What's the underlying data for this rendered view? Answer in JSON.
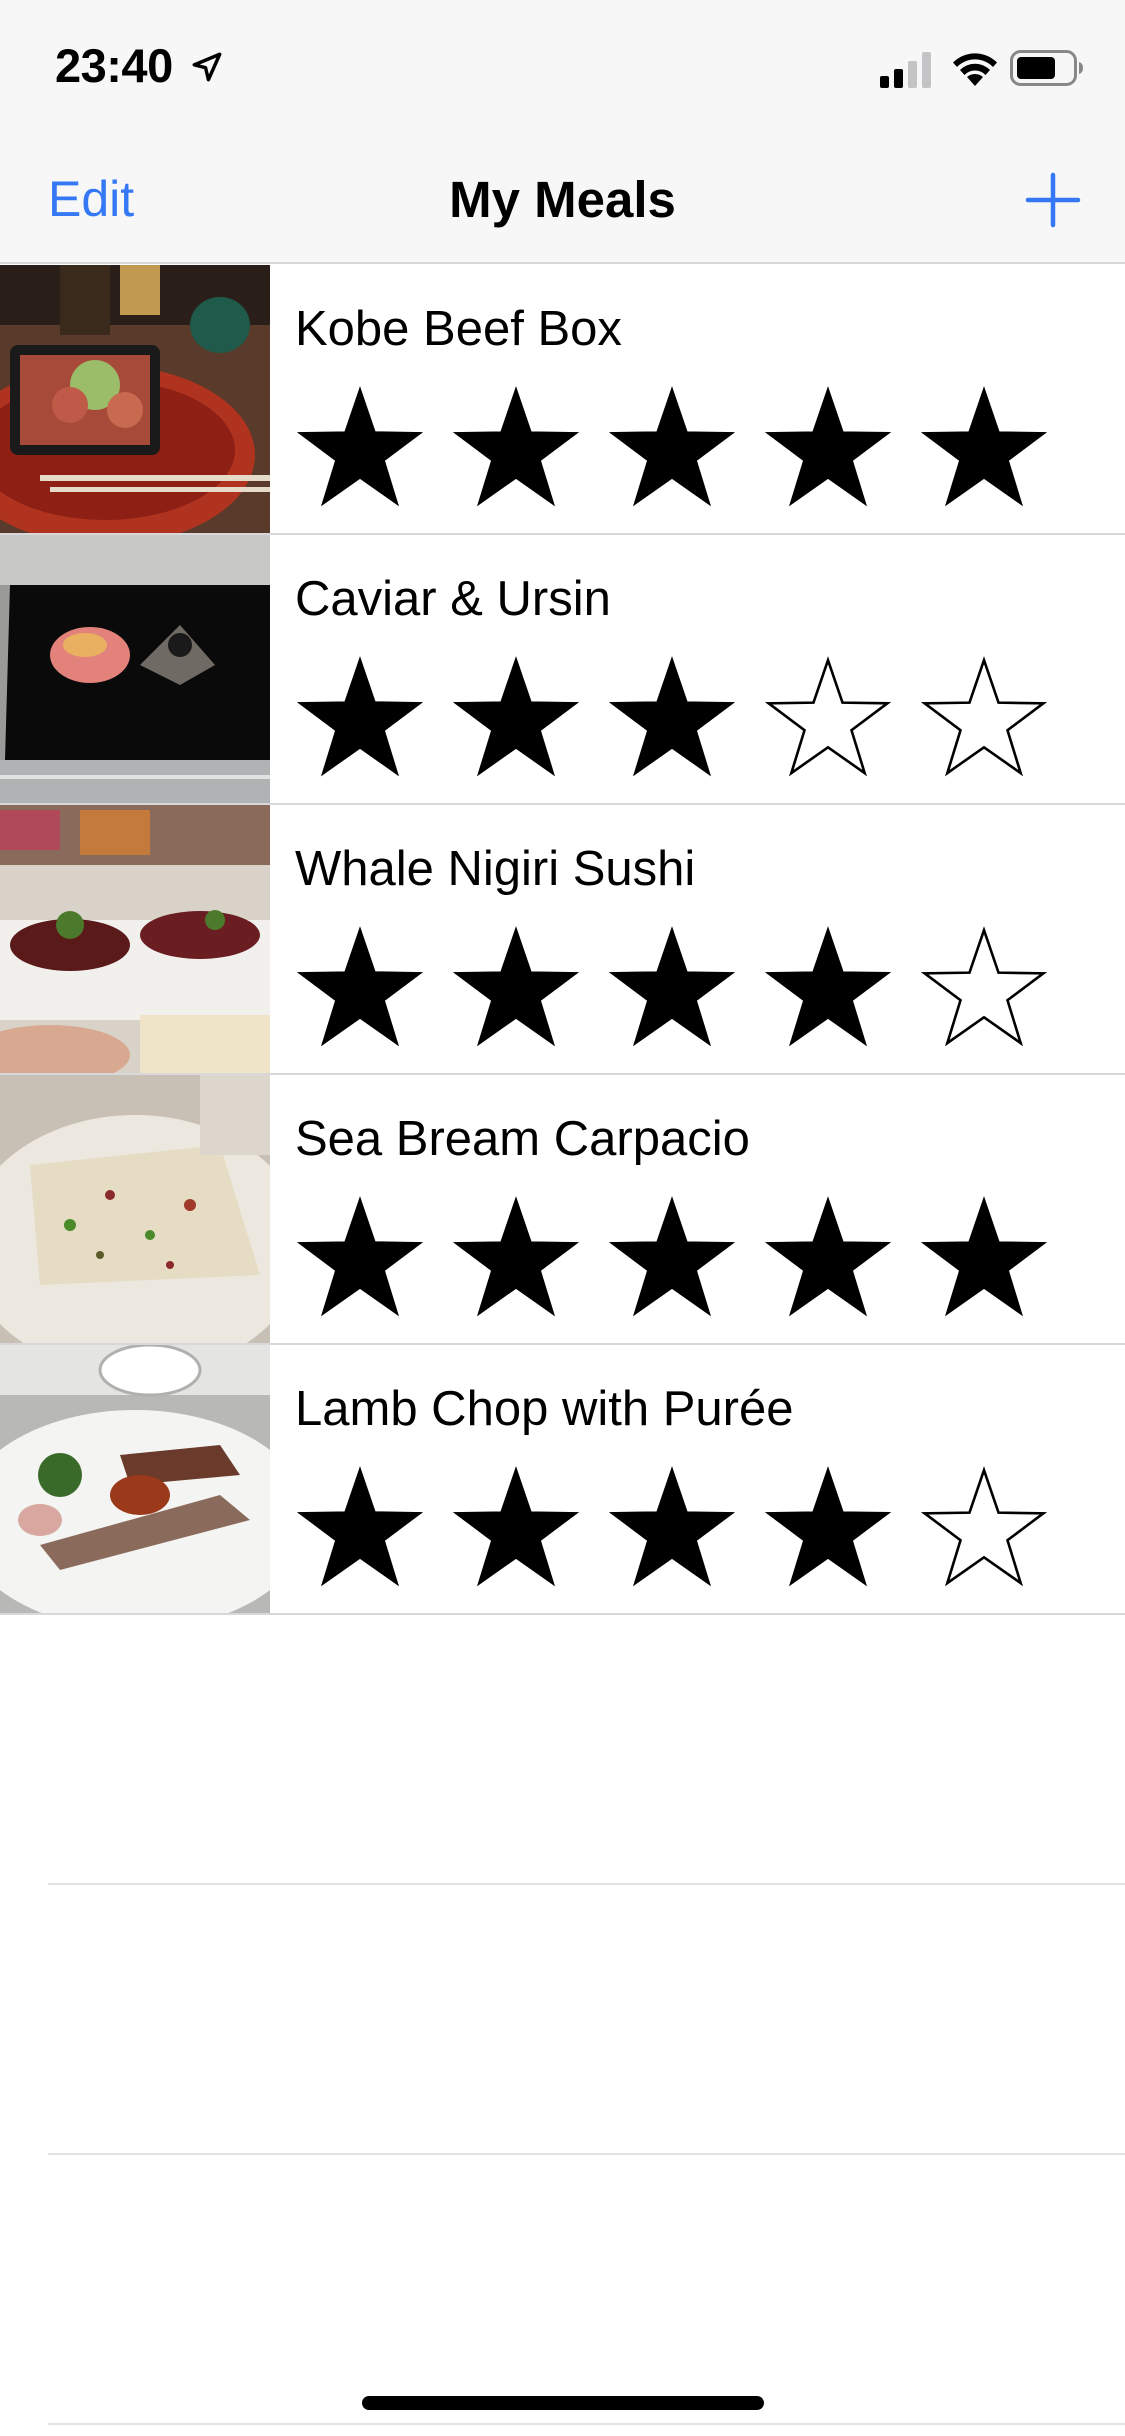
{
  "status_bar": {
    "time": "23:40",
    "icons": [
      "location-icon",
      "cellular-signal-icon",
      "wifi-icon",
      "battery-icon"
    ]
  },
  "nav": {
    "edit_label": "Edit",
    "title": "My Meals",
    "add_icon": "plus-icon"
  },
  "colors": {
    "accent": "#3478f6",
    "separator": "#d8d8da",
    "bar_background": "#f7f7f7"
  },
  "meals": [
    {
      "name": "Kobe Beef Box",
      "rating": 5,
      "max_rating": 5
    },
    {
      "name": "Caviar & Ursin",
      "rating": 3,
      "max_rating": 5
    },
    {
      "name": "Whale Nigiri Sushi",
      "rating": 4,
      "max_rating": 5
    },
    {
      "name": "Sea Bream Carpacio",
      "rating": 5,
      "max_rating": 5
    },
    {
      "name": "Lamb Chop with Purée",
      "rating": 4,
      "max_rating": 5
    }
  ]
}
